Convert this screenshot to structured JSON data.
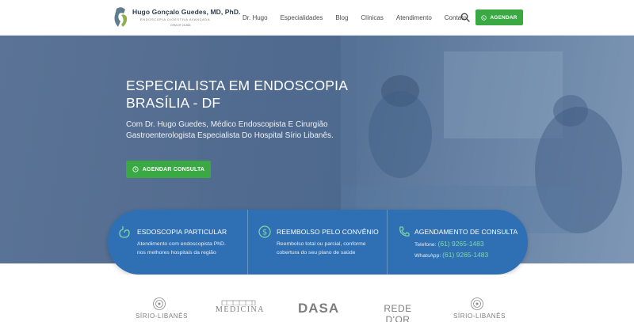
{
  "header": {
    "logo": {
      "name": "Hugo Gonçalo Guedes, MD, PhD.",
      "subtitle": "ENDOSCOPIA DIGESTIVA AVANÇADA",
      "crm": "CRM-DF 25.863"
    },
    "nav": [
      "Dr. Hugo",
      "Especialidades",
      "Blog",
      "Clínicas",
      "Atendimento",
      "Contato"
    ],
    "agendar_label": "AGENDAR"
  },
  "hero": {
    "title_line1": "ESPECIALISTA EM ENDOSCOPIA",
    "title_line2": "BRASÍLIA - DF",
    "desc_line1": "Com Dr. Hugo Guedes, Médico Endoscopista E Cirurgião",
    "desc_line2": "Gastroenterologista Especialista Do Hospital Sírio Libanês.",
    "cta_label": "AGENDAR CONSULTA"
  },
  "features": [
    {
      "title": "ESDOSCOPIA PARTICULAR",
      "line1": "Atendimento com endoscopista PhD.",
      "line2": "nos melhores hospitais da região"
    },
    {
      "title": "REEMBOLSO PELO CONVÊNIO",
      "line1": "Reembolso total ou parcial, conforme",
      "line2": "cobertura do seu plano de saúde"
    },
    {
      "title": "AGENDAMENTO DE CONSULTA",
      "phone_label": "Telefone:",
      "phone": "(61) 9265-1483",
      "whatsapp_label": "WhatsApp:",
      "whatsapp": "(61) 9265-1483"
    }
  ],
  "partners": {
    "sirio1": "SÍRIO-LIBANÊS",
    "medicina": "MEDICINA",
    "dasa": "DASA",
    "rededor": "REDE D'OR",
    "sirio2": "SÍRIO-LIBANÊS"
  },
  "colors": {
    "accent_green": "#3aa843",
    "feature_blue": "#2f6fb4",
    "phone_green": "#7fd9a5"
  }
}
